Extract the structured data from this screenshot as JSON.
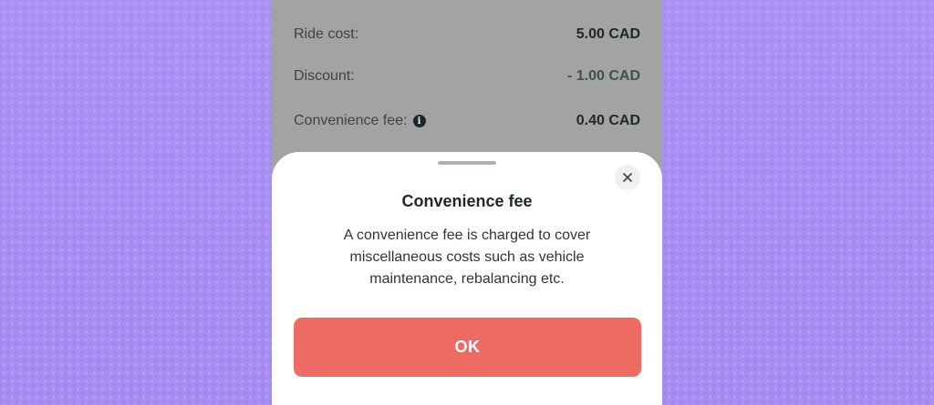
{
  "fees": {
    "ride_cost": {
      "label": "Ride cost:",
      "value": "5.00 CAD"
    },
    "discount": {
      "label": "Discount:",
      "value": "- 1.00 CAD"
    },
    "convenience_fee": {
      "label": "Convenience fee:",
      "value": "0.40 CAD",
      "info_icon": "info-icon"
    }
  },
  "sheet": {
    "title": "Convenience fee",
    "description": "A convenience fee is charged to cover miscellaneous costs such as vehicle maintenance, rebalancing etc.",
    "ok_label": "OK",
    "close_icon": "close-icon"
  },
  "colors": {
    "accent_button": "#ee6b63",
    "background": "#a88df2",
    "overlay": "#a3a3a3"
  }
}
